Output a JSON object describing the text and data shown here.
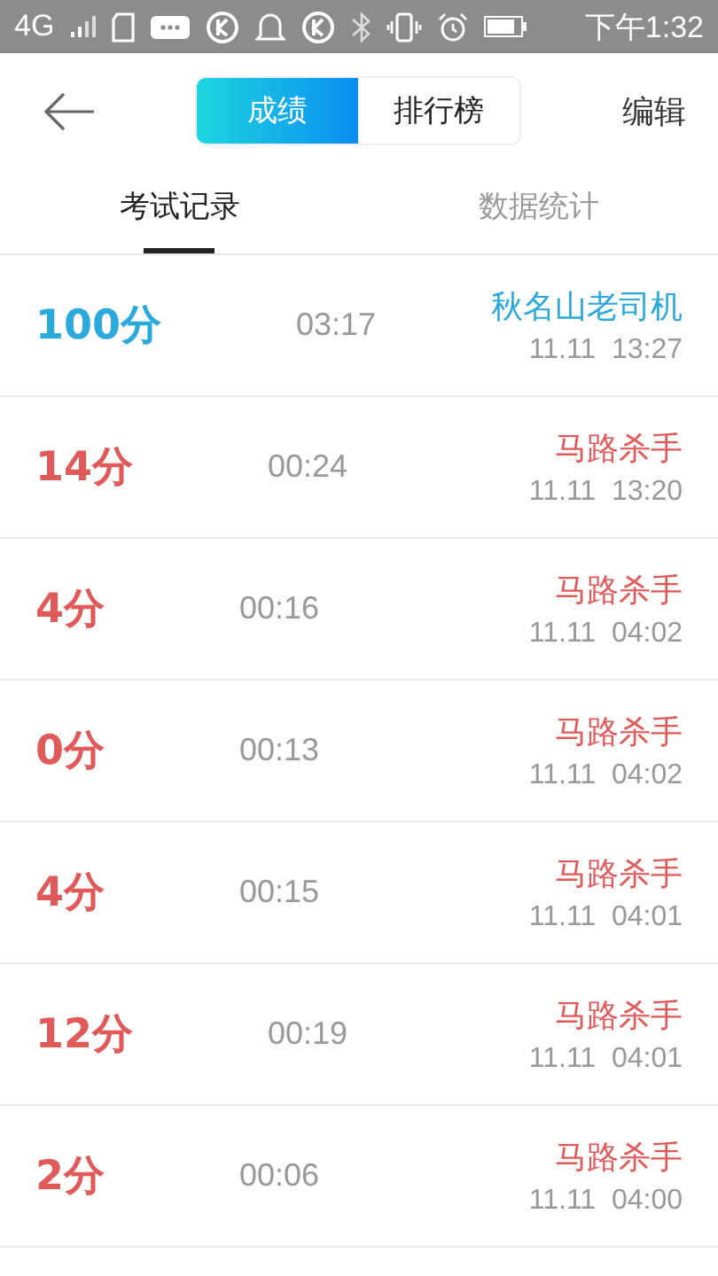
{
  "status_bar": {
    "network": "4G",
    "time": "下午1:32"
  },
  "header": {
    "segments": [
      {
        "label": "成绩",
        "selected": true
      },
      {
        "label": "排行榜",
        "selected": false
      }
    ],
    "edit": "编辑"
  },
  "tabs": [
    {
      "label": "考试记录",
      "selected": true
    },
    {
      "label": "数据统计",
      "selected": false
    }
  ],
  "records": [
    {
      "score": "100分",
      "duration": "03:17",
      "title": "秋名山老司机",
      "date": "11.11  13:27",
      "color": "#29a9dc"
    },
    {
      "score": "14分",
      "duration": "00:24",
      "title": "马路杀手",
      "date": "11.11  13:20",
      "color": "#e05a5a"
    },
    {
      "score": "4分",
      "duration": "00:16",
      "title": "马路杀手",
      "date": "11.11  04:02",
      "color": "#e05a5a"
    },
    {
      "score": "0分",
      "duration": "00:13",
      "title": "马路杀手",
      "date": "11.11  04:02",
      "color": "#e05a5a"
    },
    {
      "score": "4分",
      "duration": "00:15",
      "title": "马路杀手",
      "date": "11.11  04:01",
      "color": "#e05a5a"
    },
    {
      "score": "12分",
      "duration": "00:19",
      "title": "马路杀手",
      "date": "11.11  04:01",
      "color": "#e05a5a"
    },
    {
      "score": "2分",
      "duration": "00:06",
      "title": "马路杀手",
      "date": "11.11  04:00",
      "color": "#e05a5a"
    }
  ]
}
